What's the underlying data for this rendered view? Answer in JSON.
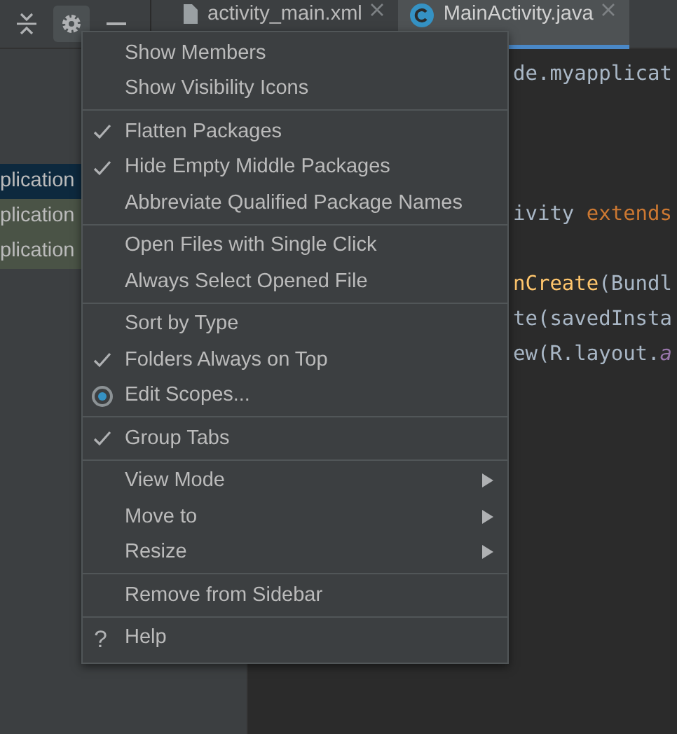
{
  "toolbar": {
    "settings_pressed": true
  },
  "tabs": [
    {
      "label": "activity_main.xml",
      "selected": false
    },
    {
      "label": "MainActivity.java",
      "selected": true
    }
  ],
  "project_tree": {
    "rows": [
      {
        "label": "plication",
        "selected": true
      },
      {
        "label": "plication",
        "selected": false
      },
      {
        "label": "plication",
        "selected": false
      }
    ]
  },
  "editor": {
    "lines": [
      {
        "kind": "code",
        "segments": [
          {
            "text": "de.myapplicat",
            "kind": "plain"
          }
        ]
      },
      {
        "kind": "blank"
      },
      {
        "kind": "blank"
      },
      {
        "kind": "blank"
      },
      {
        "kind": "code",
        "segments": [
          {
            "text": "ivity ",
            "kind": "plain"
          },
          {
            "text": "extends",
            "kind": "keyword"
          }
        ]
      },
      {
        "kind": "blank"
      },
      {
        "kind": "code",
        "segments": [
          {
            "text": "nCreate",
            "kind": "method"
          },
          {
            "text": "(Bundl",
            "kind": "plain"
          }
        ]
      },
      {
        "kind": "code",
        "segments": [
          {
            "text": "te(savedInsta",
            "kind": "plain"
          }
        ]
      },
      {
        "kind": "code",
        "segments": [
          {
            "text": "ew(R.layout.",
            "kind": "plain"
          },
          {
            "text": "a",
            "kind": "field"
          }
        ]
      }
    ]
  },
  "menu": {
    "groups": [
      {
        "items": [
          {
            "label": "Show Members",
            "kind": "check",
            "checked": false
          },
          {
            "label": "Show Visibility Icons",
            "kind": "check",
            "checked": false
          }
        ]
      },
      {
        "items": [
          {
            "label": "Flatten Packages",
            "kind": "check",
            "checked": true
          },
          {
            "label": "Hide Empty Middle Packages",
            "kind": "check",
            "checked": true
          },
          {
            "label": "Abbreviate Qualified Package Names",
            "kind": "check",
            "checked": false
          }
        ]
      },
      {
        "items": [
          {
            "label": "Open Files with Single Click",
            "kind": "check",
            "checked": false
          },
          {
            "label": "Always Select Opened File",
            "kind": "check",
            "checked": false
          }
        ]
      },
      {
        "items": [
          {
            "label": "Sort by Type",
            "kind": "check",
            "checked": false
          },
          {
            "label": "Folders Always on Top",
            "kind": "check",
            "checked": true
          },
          {
            "label": "Edit Scopes...",
            "kind": "radio",
            "selected": true
          }
        ]
      },
      {
        "items": [
          {
            "label": "Group Tabs",
            "kind": "check",
            "checked": true
          }
        ]
      },
      {
        "items": [
          {
            "label": "View Mode",
            "kind": "submenu"
          },
          {
            "label": "Move to",
            "kind": "submenu"
          },
          {
            "label": "Resize",
            "kind": "submenu"
          }
        ]
      },
      {
        "items": [
          {
            "label": "Remove from Sidebar",
            "kind": "action"
          }
        ]
      },
      {
        "items": [
          {
            "label": "Help",
            "kind": "help",
            "icon": "?"
          }
        ]
      }
    ]
  }
}
